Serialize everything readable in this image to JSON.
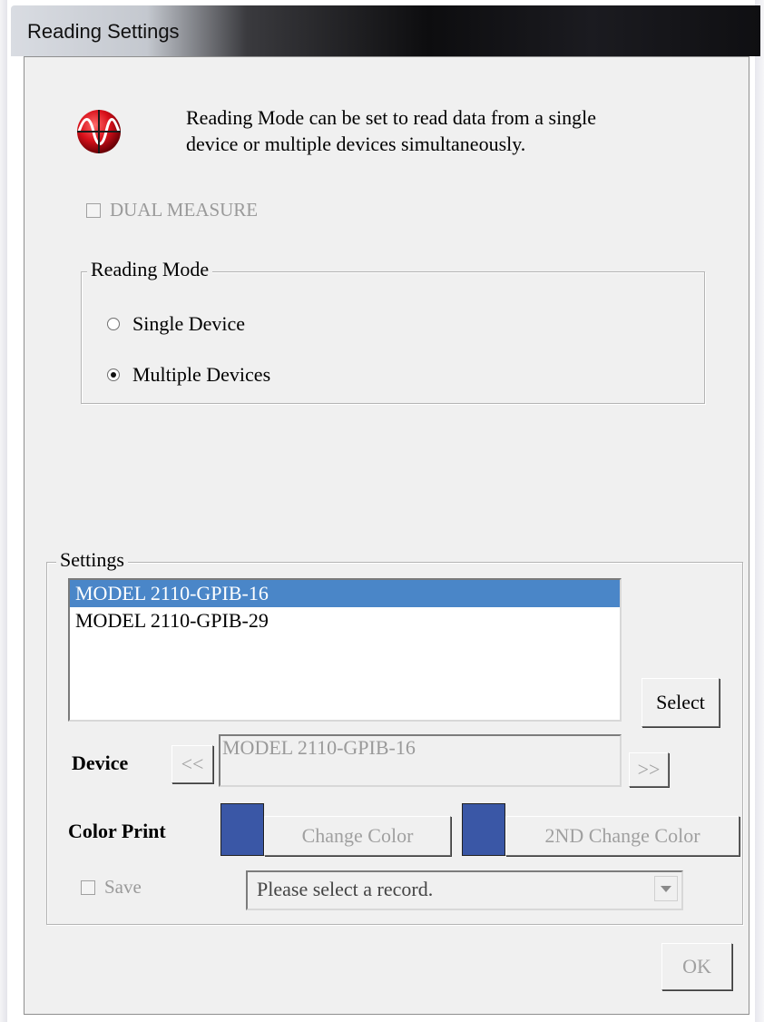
{
  "window": {
    "title": "Reading Settings"
  },
  "info": {
    "description_line1": "Reading Mode can be set to read data from a single",
    "description_line2": "device or multiple devices simultaneously."
  },
  "dual_measure": {
    "label": "DUAL MEASURE",
    "checked": false,
    "enabled": false
  },
  "reading_mode": {
    "legend": "Reading Mode",
    "options": [
      {
        "label": "Single Device",
        "selected": false
      },
      {
        "label": "Multiple Devices",
        "selected": true
      }
    ]
  },
  "settings": {
    "legend": "Settings",
    "devices": [
      {
        "label": "MODEL 2110-GPIB-16",
        "selected": true
      },
      {
        "label": "MODEL 2110-GPIB-29",
        "selected": false
      }
    ],
    "select_button": "Select",
    "device_label": "Device",
    "prev_button": "<<",
    "next_button": ">>",
    "device_value": "MODEL 2110-GPIB-16",
    "color_print_label": "Color Print",
    "change_color_button": "Change Color",
    "change_color2_button": "2ND Change Color",
    "swatch_color": "#3a57a6",
    "save_label": "Save",
    "record_placeholder": "Please select a record."
  },
  "ok_button": "OK"
}
